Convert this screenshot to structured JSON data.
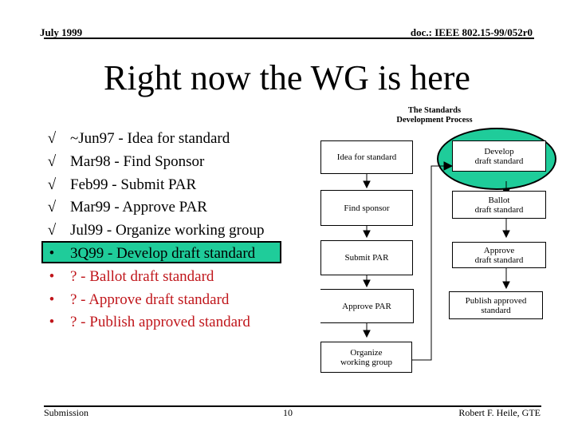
{
  "header": {
    "date": "July 1999",
    "doc_id": "doc.: IEEE 802.15-99/052r0"
  },
  "title": "Right now the WG is here",
  "bullets": [
    {
      "mark": "√",
      "text": "~Jun97 - Idea for standard",
      "status": "done"
    },
    {
      "mark": "√",
      "text": "Mar98 - Find Sponsor",
      "status": "done"
    },
    {
      "mark": "√",
      "text": "Feb99 - Submit PAR",
      "status": "done"
    },
    {
      "mark": "√",
      "text": "Mar99 - Approve PAR",
      "status": "done"
    },
    {
      "mark": "√",
      "text": "Jul99 - Organize working group",
      "status": "done"
    },
    {
      "mark": "•",
      "text": "3Q99 - Develop draft standard",
      "status": "current"
    },
    {
      "mark": "•",
      "text": "? - Ballot draft standard",
      "status": "future"
    },
    {
      "mark": "•",
      "text": "? - Approve draft standard",
      "status": "future"
    },
    {
      "mark": "•",
      "text": "? - Publish approved standard",
      "status": "future"
    }
  ],
  "diagram": {
    "title": "The Standards\nDevelopment Process",
    "left_column": [
      "Idea for standard",
      "Find sponsor",
      "Submit PAR",
      "Approve PAR",
      "Organize\nworking group"
    ],
    "right_column": [
      "Develop\ndraft standard",
      "Ballot\ndraft standard",
      "Approve\ndraft standard",
      "Publish approved\nstandard"
    ],
    "highlight_color": "#1fcc9a"
  },
  "colors": {
    "current_highlight": "#1fcc9a",
    "future_text": "#c0161b"
  },
  "footer": {
    "left": "Submission",
    "page": "10",
    "right": "Robert F. Heile, GTE"
  }
}
